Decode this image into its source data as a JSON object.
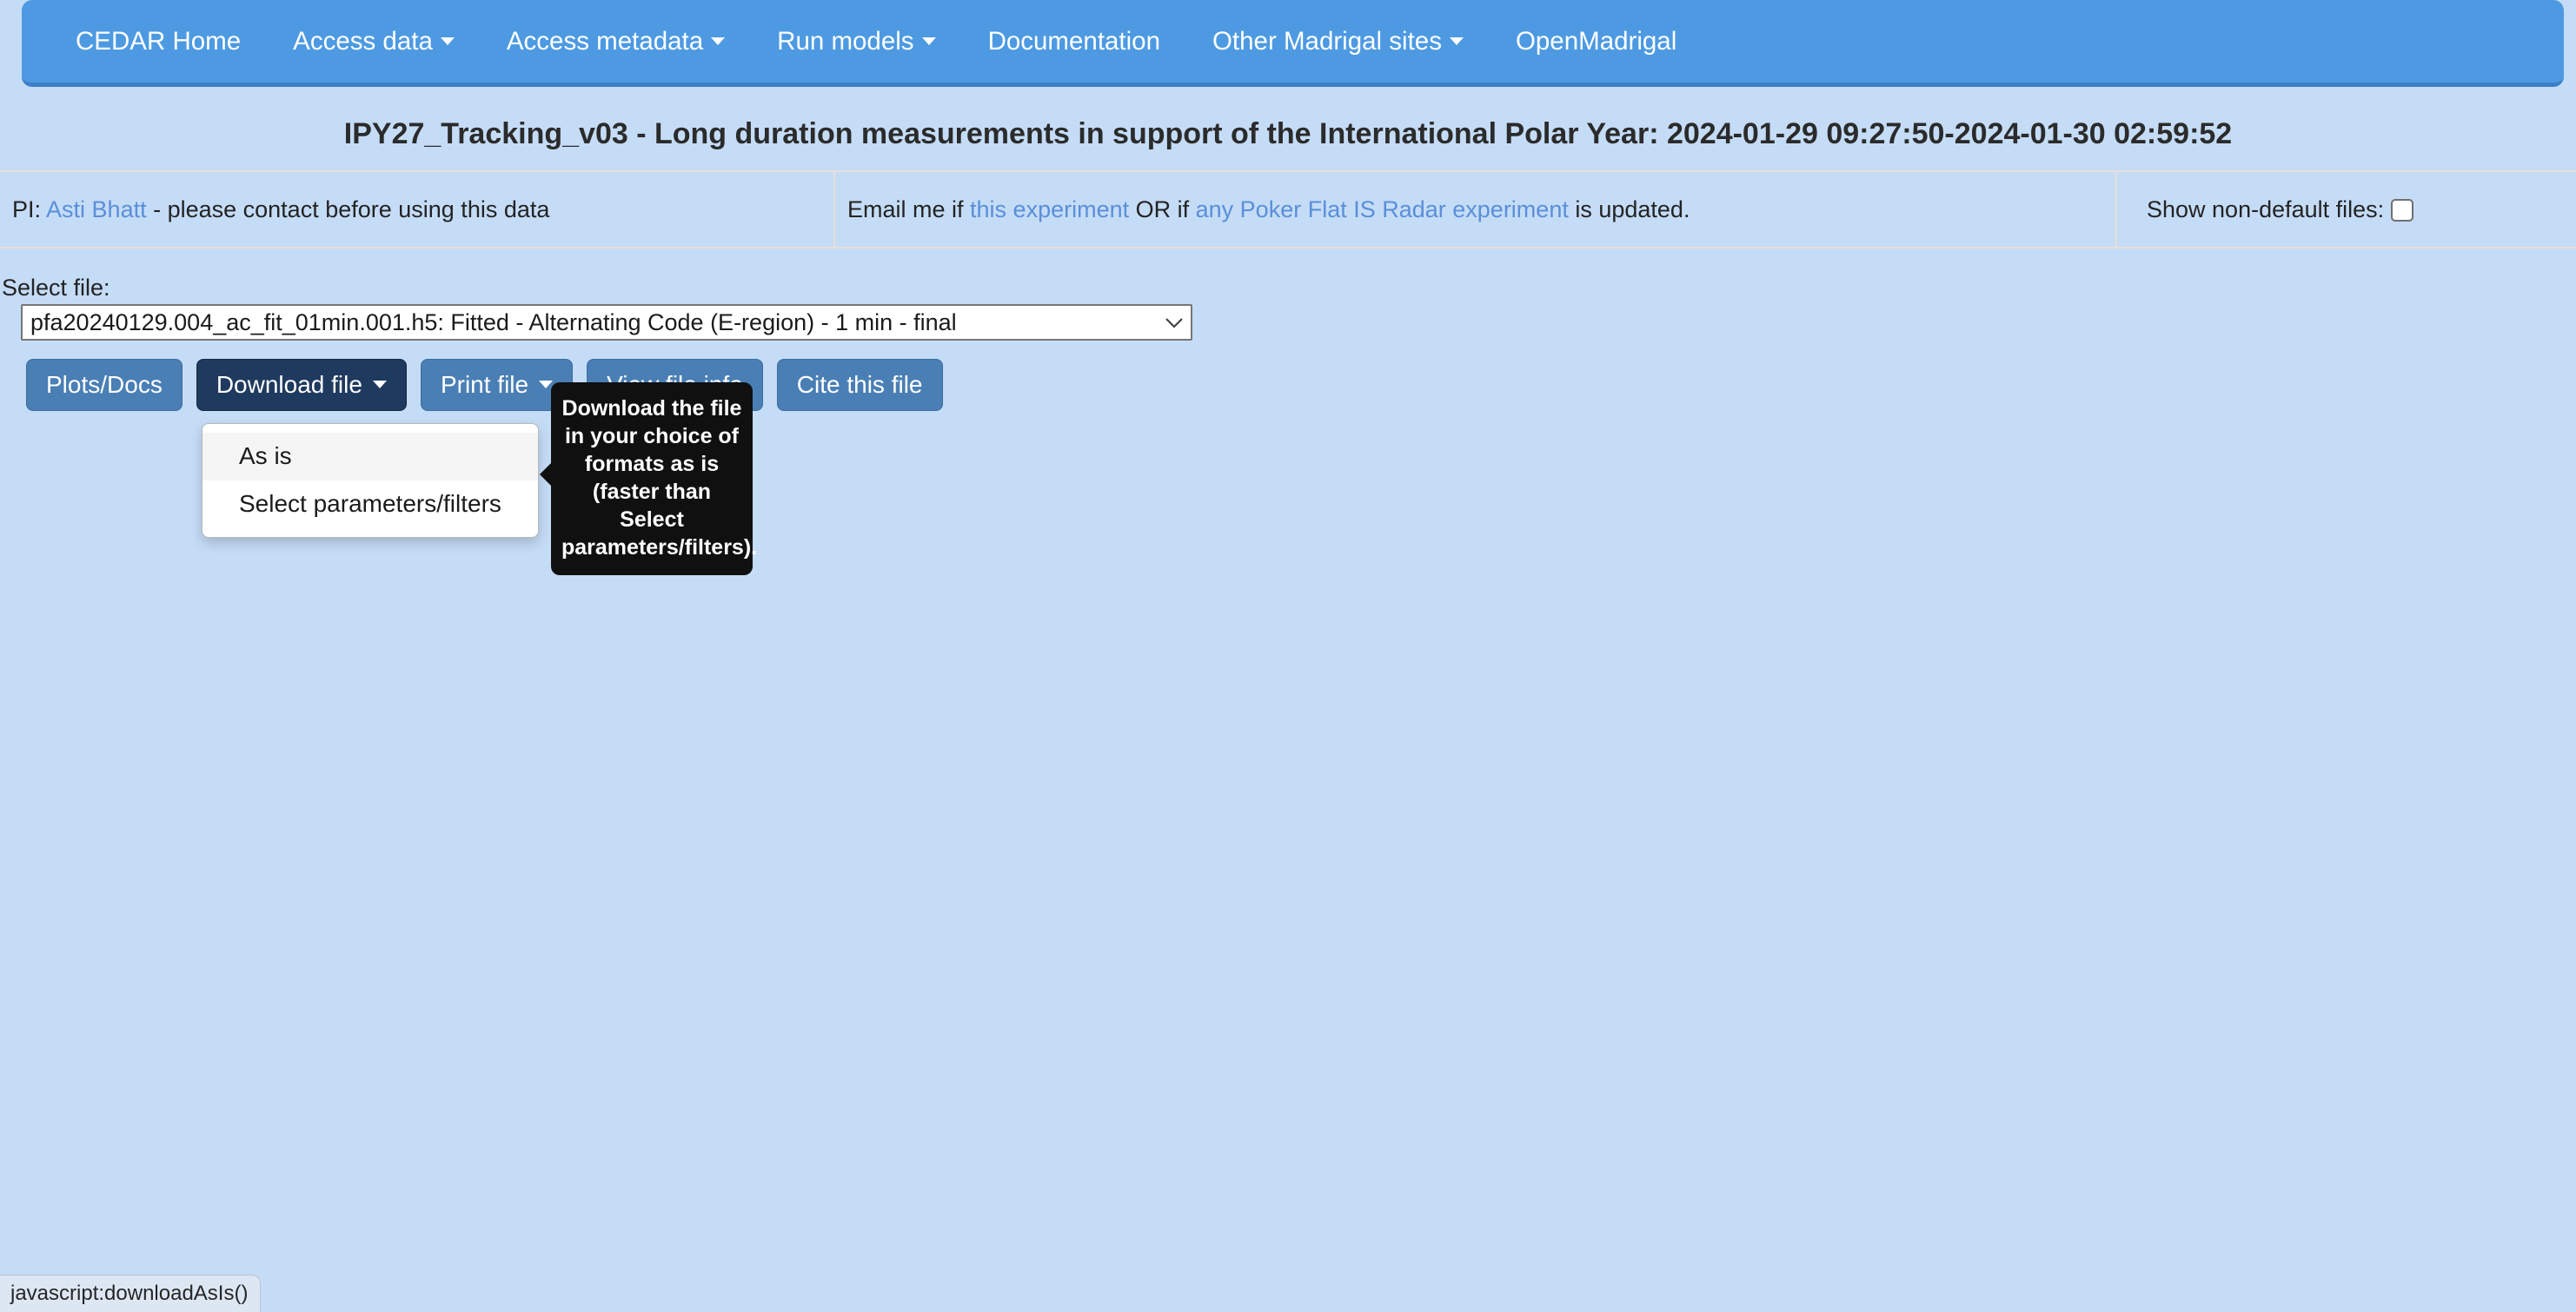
{
  "navbar": {
    "items": [
      {
        "label": "CEDAR Home",
        "caret": false,
        "icon": null
      },
      {
        "label": "Access data",
        "caret": true,
        "icon": "caret-down-icon"
      },
      {
        "label": "Access metadata",
        "caret": true,
        "icon": "caret-down-icon"
      },
      {
        "label": "Run models",
        "caret": true,
        "icon": "caret-down-icon"
      },
      {
        "label": "Documentation",
        "caret": false,
        "icon": null
      },
      {
        "label": "Other Madrigal sites",
        "caret": true,
        "icon": "caret-down-icon"
      },
      {
        "label": "OpenMadrigal",
        "caret": false,
        "icon": null
      }
    ]
  },
  "page": {
    "title": "IPY27_Tracking_v03 - Long duration measurements in support of the International Polar Year: 2024-01-29 09:27:50-2024-01-30 02:59:52"
  },
  "info": {
    "pi_prefix": "PI:",
    "pi_name": "Asti Bhatt",
    "pi_suffix": " - please contact before using this data",
    "email_prefix": "Email me if ",
    "email_link1": "this experiment",
    "email_middle": " OR if ",
    "email_link2": "any Poker Flat IS Radar experiment",
    "email_suffix": " is updated.",
    "show_nondefault_label": "Show non-default files:",
    "show_nondefault_checked": false
  },
  "select_file": {
    "label": "Select file:",
    "selected": "pfa20240129.004_ac_fit_01min.001.h5: Fitted - Alternating Code (E-region) - 1 min - final",
    "options": [
      "pfa20240129.004_ac_fit_01min.001.h5: Fitted - Alternating Code (E-region) - 1 min - final"
    ]
  },
  "buttons": [
    {
      "label": "Plots/Docs",
      "caret": false,
      "active": false,
      "name": "plots-docs-button"
    },
    {
      "label": "Download file",
      "caret": true,
      "active": true,
      "name": "download-file-button"
    },
    {
      "label": "Print file",
      "caret": true,
      "active": false,
      "name": "print-file-button"
    },
    {
      "label": "View file info",
      "caret": false,
      "active": false,
      "name": "view-file-info-button"
    },
    {
      "label": "Cite this file",
      "caret": false,
      "active": false,
      "name": "cite-this-file-button"
    }
  ],
  "dropdown": {
    "items": [
      {
        "label": "As is",
        "hovered": true
      },
      {
        "label": "Select parameters/filters",
        "hovered": false
      }
    ]
  },
  "tooltip": {
    "text": "Download the file in your choice of formats as is (faster than Select parameters/filters)."
  },
  "statusbar": {
    "text": "javascript:downloadAsIs()"
  },
  "colors": {
    "page_background": "#c5dcf7",
    "navbar": "#4d9ae2",
    "navbar_border": "#3b7fc9",
    "button": "#4a7fb5",
    "button_active": "#1f3a5f",
    "link": "#5a8fd8",
    "tooltip_bg": "#101010",
    "text": "#232323"
  }
}
